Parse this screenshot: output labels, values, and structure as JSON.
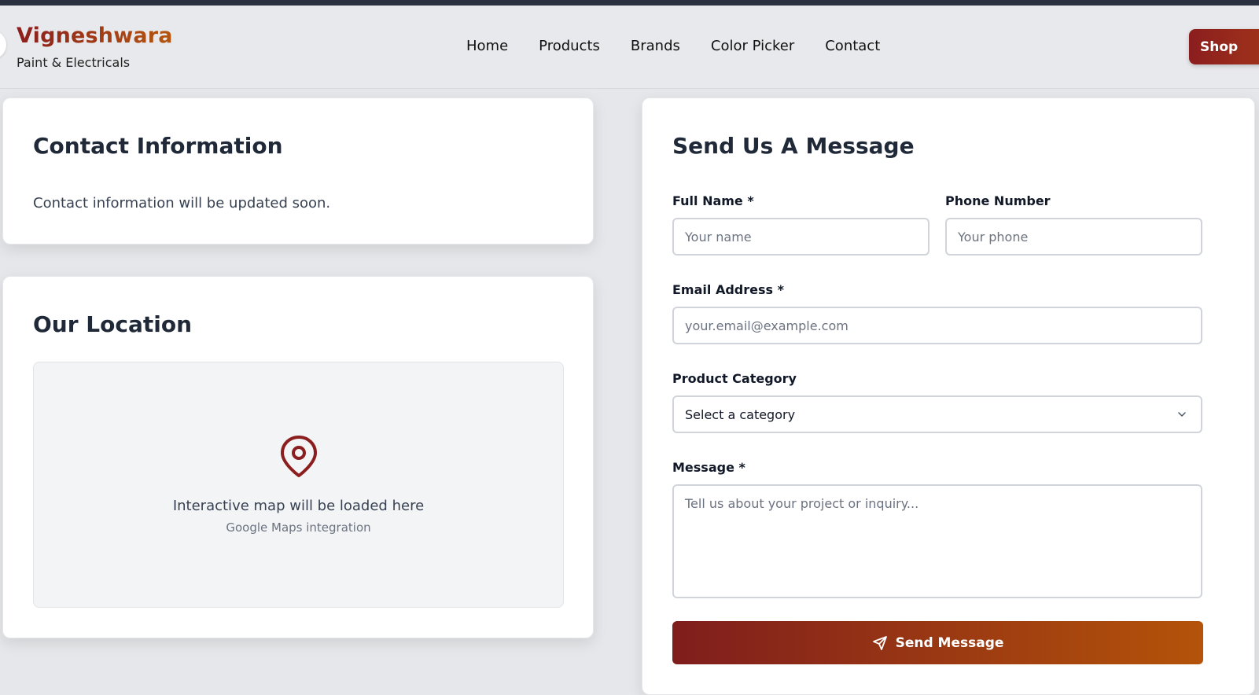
{
  "header": {
    "brand_title": "Vigneshwara",
    "brand_subtitle": "Paint & Electricals",
    "nav": [
      "Home",
      "Products",
      "Brands",
      "Color Picker",
      "Contact"
    ],
    "shop_label": "Shop"
  },
  "contact_info": {
    "title": "Contact Information",
    "text": "Contact information will be updated soon."
  },
  "location": {
    "title": "Our Location",
    "map_title": "Interactive map will be loaded here",
    "map_subtitle": "Google Maps integration"
  },
  "form": {
    "title": "Send Us A Message",
    "full_name": {
      "label": "Full Name *",
      "placeholder": "Your name"
    },
    "phone": {
      "label": "Phone Number",
      "placeholder": "Your phone"
    },
    "email": {
      "label": "Email Address *",
      "placeholder": "your.email@example.com"
    },
    "category": {
      "label": "Product Category",
      "value": "Select a category"
    },
    "message": {
      "label": "Message *",
      "placeholder": "Tell us about your project or inquiry..."
    },
    "submit_label": "Send Message"
  },
  "colors": {
    "brand_dark": "#7f1d1d",
    "brand_orange": "#b45309",
    "pin": "#8b1e1e"
  },
  "icons": {
    "map": "map-pin-icon",
    "send": "send-icon",
    "select": "chevron-down-icon"
  }
}
